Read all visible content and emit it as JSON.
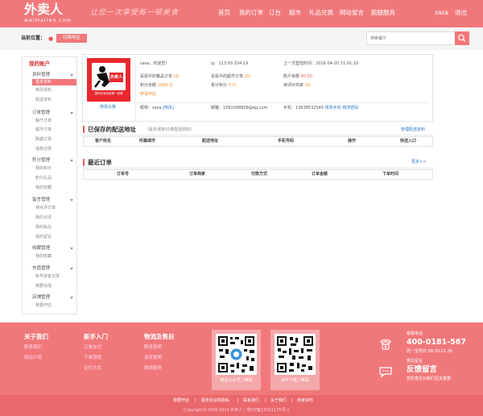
{
  "header": {
    "logo": "外卖人",
    "logo_sub": "waimairen.com",
    "slogan": "让您一次享受每一顿美食",
    "nav": [
      "首页",
      "我的订单",
      "订台",
      "超市",
      "礼品兑换",
      "网站留言",
      "跑腿服务"
    ],
    "user": "sasa",
    "logout": "退出"
  },
  "location": {
    "label": "当前位置：",
    "switch": "切换地区"
  },
  "search": {
    "placeholder": "搜索餐厅"
  },
  "sidebar": {
    "title": "我的账户",
    "groups": [
      {
        "label": "资料管理",
        "items": [
          "基本资料",
          "修改资料",
          "配送资料"
        ]
      },
      {
        "label": "订单管理",
        "items": [
          "餐厅订单",
          "超市订单",
          "跑腿订单",
          "退款记录"
        ]
      },
      {
        "label": "积分管理",
        "items": [
          "我的积分",
          "积分礼品",
          "我的收藏"
        ]
      },
      {
        "label": "留言管理",
        "items": [
          "待点评订单",
          "我的点评",
          "我的私信",
          "我的留言"
        ]
      },
      {
        "label": "收藏管理",
        "items": [
          "我的收藏"
        ]
      },
      {
        "label": "充值管理",
        "items": [
          "帐号资金记录",
          "我要充值"
        ]
      },
      {
        "label": "店铺管理",
        "items": [
          "我要开店"
        ]
      }
    ]
  },
  "account": {
    "avatar_badge": "外卖人",
    "avatar_caption": "国内外卖系统第一品牌",
    "edit_avatar": "修改头像",
    "greeting": "sasa，欢迎您！",
    "ip_label": "ip：",
    "ip": "113.93.204.19",
    "last_login_label": "上一次登陆时间：",
    "last_login": "2016-04-20 11:01:10",
    "rest_orders_label": "妥投中的餐品订单",
    "rest_orders": "(0)",
    "market_orders_label": "妥投中的超市订单",
    "market_orders": "(0)",
    "balance_label": "账户余额",
    "balance": "¥0.00",
    "points_label": "积分余额",
    "points": "1000 分",
    "total_points_label": "累计积分",
    "total_points": "0 分",
    "to_review_label": "待评价商家",
    "to_review": "(0)",
    "activate": "申请开店",
    "nickname_label": "昵称：sasa",
    "nickname_edit": "[修改]",
    "email_label": "邮箱：",
    "email": "1091098809@qq.com",
    "phone_label": "手机：",
    "phone": "13638532545",
    "phone_edit": "修改手机",
    "pwd_edit": "修改密码"
  },
  "address_section": {
    "title": "已保存的配送地址",
    "note": "（最多保存10条配送资料）",
    "manage": "管理配送资料",
    "columns": [
      "客户姓名",
      "所属城市",
      "配送地址",
      "手机号码",
      "操作",
      "快送入口"
    ]
  },
  "orders_section": {
    "title": "最近订单",
    "more": "更多>>",
    "columns": [
      "订单号",
      "订单商家",
      "付款方式",
      "订单金额",
      "下单时间"
    ]
  },
  "footer": {
    "col1": {
      "title": "关于我们",
      "items": [
        "联系我们",
        "网站介绍"
      ]
    },
    "col2": {
      "title": "新手入门",
      "items": [
        "订单支付",
        "下单流程",
        "支付方式"
      ]
    },
    "col3": {
      "title": "物流及售后",
      "items": [
        "配送说明",
        "退货说明",
        "物流服务"
      ]
    },
    "qr1": "微信公众号二维码",
    "qr2": "APP下载二维码",
    "hotline_label": "客服电话",
    "hotline": "400-0181-567",
    "hours": "周一至周日 09:30-21:30",
    "feedback_label": "意见留言",
    "feedback": "反馈留言",
    "feedback_note": "您的意见对我们至关重要",
    "links": [
      "我要开店",
      "服务协议和隐私",
      "联系我们",
      "关于我们",
      "商家资料"
    ],
    "copyright": "Copyright©2009-2014 外卖人 | 粤ICP备13021175号-1"
  }
}
